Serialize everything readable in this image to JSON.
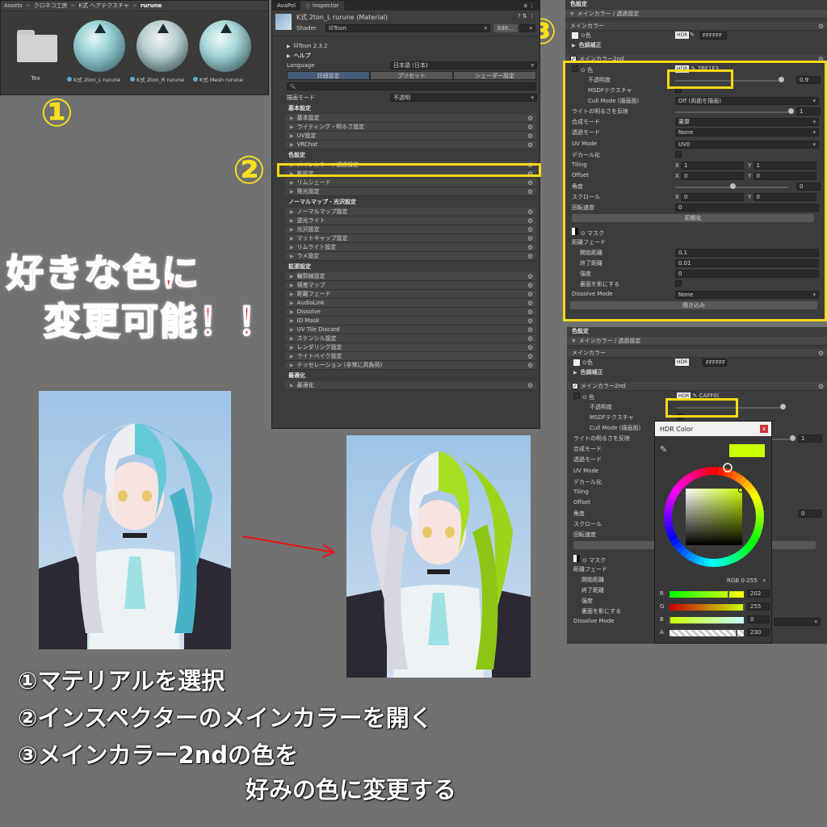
{
  "project": {
    "breadcrumb": [
      "Assets",
      ">",
      "クロネコ工房",
      ">",
      "K式 ヘアテクスチャ",
      ">",
      "rurune"
    ],
    "items": [
      {
        "label": "Tex",
        "kind": "folder"
      },
      {
        "label": "K式 2ton_L rurune",
        "kind": "material"
      },
      {
        "label": "K式 2ton_R rurune",
        "kind": "material"
      },
      {
        "label": "K式 Mesh rurune",
        "kind": "material"
      }
    ]
  },
  "steps": {
    "one": "①",
    "two": "②",
    "three": "③"
  },
  "inspector": {
    "tabs": [
      "AvaPol",
      "Inspector"
    ],
    "material_name": "K式 2ton_L rurune (Material)",
    "shader_label": "Shader",
    "shader_value": "lilToon",
    "edit_button": "Edit...",
    "version": "lilToon 2.3.2",
    "help": "ヘルプ",
    "language_label": "Language",
    "language_value": "日本語 (日本)",
    "tab_buttons": [
      "詳細設定",
      "プリセット",
      "シェーダー設定"
    ],
    "render_mode_label": "描画モード",
    "render_mode_value": "不透明",
    "basic_title": "基本設定",
    "basic_items": [
      "基本設定",
      "ライティング・明るさ設定",
      "UV設定",
      "VRChat"
    ],
    "color_title": "色設定",
    "color_items": [
      "メインカラー / 透過設定",
      "影設定",
      "リムシェード",
      "発光設定"
    ],
    "normal_title": "ノーマルマップ・光沢設定",
    "normal_items": [
      "ノーマルマップ設定",
      "逆光ライト",
      "光沢設定",
      "マットキャップ設定",
      "リムライト設定",
      "ラメ設定"
    ],
    "ext_title": "拡張設定",
    "ext_items": [
      "輪郭線設定",
      "視差マップ",
      "距離フェード",
      "AudioLink",
      "Dissolve",
      "ID Mask",
      "UV Tile Discard",
      "ステンシル設定",
      "レンダリング設定",
      "ライトベイク設定",
      "テッセレーション (非常に高負荷)"
    ],
    "opt_title": "最適化",
    "opt_items": [
      "最適化"
    ]
  },
  "panel3": {
    "title": "色設定",
    "fold": "メインカラー / 透過設定",
    "main_color": "メインカラー",
    "color_label": "色",
    "hdr": "HDR",
    "main_hex": "FFFFFF",
    "color_adjust": "色調補正",
    "main2nd": "メインカラー2nd",
    "color2_hex": "7BF1F3",
    "opacity_label": "不透明度",
    "opacity_value": "0.9",
    "msdf": "MSDFテクスチャ",
    "cull_label": "Cull Mode (描画面)",
    "cull_value": "Off (両面を描画)",
    "invert_label": "ライトの明るさを反映",
    "invert_value": "1",
    "blend_label": "合成モード",
    "blend_value": "乗算",
    "alpha_label": "透過モード",
    "alpha_value": "None",
    "uv_label": "UV Mode",
    "uv_value": "UV0",
    "decal": "デカール化",
    "tiling": "Tiling",
    "tiling_x": "1",
    "tiling_y": "1",
    "offset": "Offset",
    "offset_x": "0",
    "offset_y": "0",
    "angle": "角度",
    "angle_value": "0",
    "scroll": "スクロール",
    "scroll_x": "0",
    "scroll_y": "0",
    "rotate": "回転速度",
    "rotate_value": "0",
    "reset": "初期化",
    "mask": "マスク",
    "dist_fade": "距離フェード",
    "start": "開始距離",
    "start_value": "0.1",
    "end": "終了距離",
    "end_value": "0.01",
    "strength": "強度",
    "strength_value": "0",
    "backface": "裏面を影にする",
    "dissolve_label": "Dissolve Mode",
    "dissolve_value": "None",
    "bake": "焼き込み",
    "x": "X",
    "y": "Y"
  },
  "panel4": {
    "title": "色設定",
    "fold": "メインカラー / 透過設定",
    "main_color": "メインカラー",
    "color_label": "色",
    "hdr": "HDR",
    "main_hex": "FFFFFF",
    "color_adjust": "色調補正",
    "main2nd": "メインカラー2nd",
    "color2_hex": "CAFF0(",
    "opacity_label": "不透明度",
    "opacity_value": "0.9",
    "msdf": "MSDFテクスチャ",
    "cull_label": "Cull Mode (描画面)",
    "invert_label": "ライトの明るさを反映",
    "invert_value": "1",
    "blend_label": "合成モード",
    "alpha_label": "透過モード",
    "uv_label": "UV Mode",
    "decal": "デカール化",
    "tiling": "Tiling",
    "offset": "Offset",
    "angle": "角度",
    "angle_value": "0",
    "scroll": "スクロール",
    "rotate": "回転速度",
    "mask": "マスク",
    "dist_fade": "距離フェード",
    "start": "開始距離",
    "end": "終了距離",
    "strength": "強度",
    "backface": "裏面を影にする",
    "dissolve_label": "Dissolve Mode"
  },
  "hdr_dialog": {
    "title": "HDR Color",
    "close": "x",
    "mode": "RGB 0-255",
    "r_label": "R",
    "r_value": "202",
    "g_label": "G",
    "g_value": "255",
    "b_label": "B",
    "b_value": "0",
    "a_label": "A",
    "a_value": "230",
    "swatch": "#CAFF00"
  },
  "caption": {
    "line1": "好きな色に",
    "line2": "変更可能！！"
  },
  "instructions": {
    "i1": "①マテリアルを選択",
    "i2": "②インスペクターのメインカラーを開く",
    "i3": "③メインカラー2ndの色を",
    "i4": "好みの色に変更する"
  },
  "colors": {
    "accent_yellow": "#F5DA17",
    "hair_before": "#7BF1F3",
    "hair_after": "#CAFF00",
    "caption_red": "#FF1A1A"
  }
}
